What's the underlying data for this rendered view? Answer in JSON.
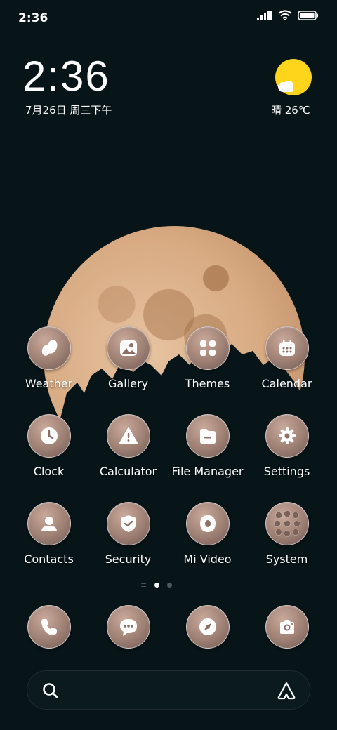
{
  "status_bar": {
    "time": "2:36"
  },
  "clock_widget": {
    "time": "2:36",
    "date": "7月26日 周三下午"
  },
  "weather_widget": {
    "text": "晴 26℃",
    "icon": "sunny-partly-cloudy-icon",
    "sun_color": "#ffd51c"
  },
  "apps": [
    {
      "label": "Weather",
      "icon": "weather-icon"
    },
    {
      "label": "Gallery",
      "icon": "gallery-icon"
    },
    {
      "label": "Themes",
      "icon": "themes-icon"
    },
    {
      "label": "Calendar",
      "icon": "calendar-icon"
    },
    {
      "label": "Clock",
      "icon": "clock-icon"
    },
    {
      "label": "Calculator",
      "icon": "calculator-icon"
    },
    {
      "label": "File Manager",
      "icon": "file-manager-icon"
    },
    {
      "label": "Settings",
      "icon": "settings-icon"
    },
    {
      "label": "Contacts",
      "icon": "contacts-icon"
    },
    {
      "label": "Security",
      "icon": "security-icon"
    },
    {
      "label": "Mi Video",
      "icon": "mi-video-icon"
    },
    {
      "label": "System",
      "icon": "system-folder-icon"
    }
  ],
  "page_indicator": {
    "pages": 2,
    "current": 1
  },
  "dock": [
    {
      "icon": "phone-icon"
    },
    {
      "icon": "messages-icon"
    },
    {
      "icon": "browser-compass-icon"
    },
    {
      "icon": "camera-icon"
    }
  ],
  "search_bar": {
    "left_icon": "search-icon",
    "right_icon": "assistant-icon"
  }
}
